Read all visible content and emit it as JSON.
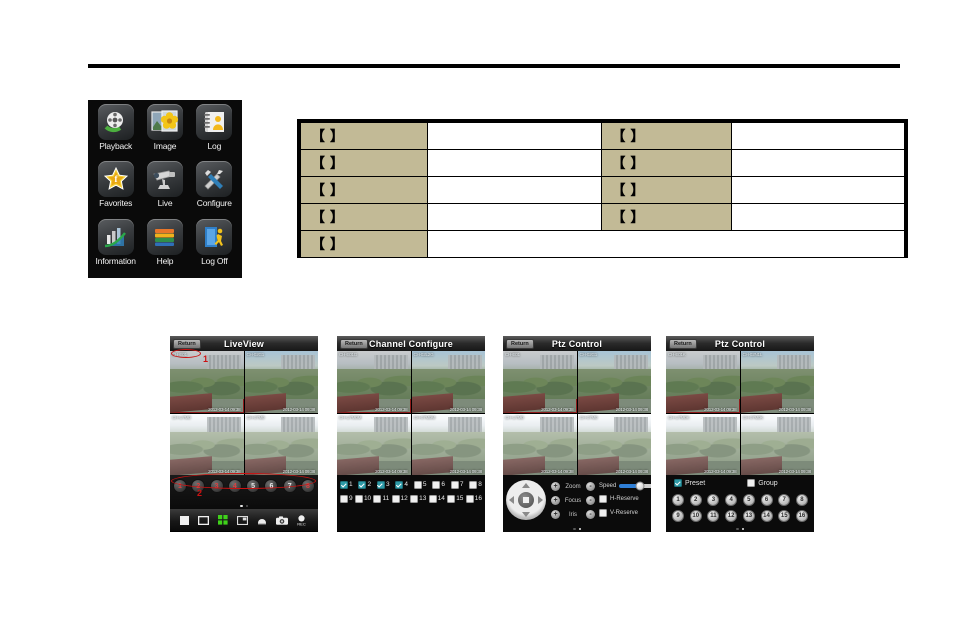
{
  "page": {
    "rule": "horizontal-rule"
  },
  "app_grid": {
    "items": [
      {
        "label": "Playback",
        "icon": "film-reel-icon"
      },
      {
        "label": "Image",
        "icon": "photo-flower-icon"
      },
      {
        "label": "Log",
        "icon": "notebook-person-icon"
      },
      {
        "label": "Favorites",
        "icon": "star-favorite-icon"
      },
      {
        "label": "Live",
        "icon": "camera-cctv-icon"
      },
      {
        "label": "Configure",
        "icon": "wrench-screwdriver-icon"
      },
      {
        "label": "Information",
        "icon": "bar-chart-icon"
      },
      {
        "label": "Help",
        "icon": "books-icon"
      },
      {
        "label": "Log Off",
        "icon": "exit-door-icon"
      }
    ]
  },
  "spec_table": {
    "colors": {
      "key_bg": "#c2ba96",
      "value_bg": "#ffffff",
      "border": "#000000"
    },
    "rows": [
      {
        "k1": "【            】",
        "v1": "",
        "k2": "【        】",
        "v2": ""
      },
      {
        "k1": "【      】",
        "v1": "",
        "k2": "【              】",
        "v2": ""
      },
      {
        "k1": "【      】",
        "v1": "",
        "k2": "【           】",
        "v2": ""
      },
      {
        "k1": "【           】",
        "v1": "",
        "k2": "【      】",
        "v2": ""
      },
      {
        "k1": "【        】",
        "v1": "",
        "merged": true
      }
    ]
  },
  "phones": [
    {
      "name": "liveview",
      "header": {
        "return_label": "Return",
        "title": "LiveView"
      },
      "tiles": [
        {
          "channel": "CH-E01",
          "timestamp": "2012-03-14 09:38",
          "selected": true
        },
        {
          "channel": "CH-02G1",
          "timestamp": "2012-03-14 09:38",
          "selected": false
        },
        {
          "channel": "CH-U7M0",
          "timestamp": "2012-03-14 09:38",
          "selected": false
        },
        {
          "channel": "CH-07M0",
          "timestamp": "2012-03-14 09:38",
          "selected": false
        }
      ],
      "channel_buttons": [
        "1",
        "2",
        "3",
        "4",
        "5",
        "6",
        "7",
        "8"
      ],
      "active_channels": [
        1,
        2,
        3,
        4
      ],
      "page_dots": 2,
      "page_dot_active": 1,
      "toolbar": [
        {
          "icon": "single-view-icon"
        },
        {
          "icon": "full-screen-icon"
        },
        {
          "icon": "quad-view-icon"
        },
        {
          "icon": "split-view-icon"
        },
        {
          "icon": "dome-ptz-icon"
        },
        {
          "icon": "snapshot-camera-icon"
        },
        {
          "icon": "record-rec-icon"
        }
      ],
      "annotations": [
        {
          "num": "1",
          "target": "channel-label"
        },
        {
          "num": "2",
          "target": "channel-button-row"
        }
      ]
    },
    {
      "name": "channel-configure",
      "header": {
        "return_label": "Return",
        "title": "Channel Configure"
      },
      "tiles": [
        {
          "channel": "CH-E01G",
          "timestamp": "2012-03-14 09:38",
          "selected": true
        },
        {
          "channel": "CH-02L2G",
          "timestamp": "2012-03-14 09:38",
          "selected": false
        },
        {
          "channel": "CH-U7M0M",
          "timestamp": "2012-03-14 09:38",
          "selected": false
        },
        {
          "channel": "CH-07M0M",
          "timestamp": "2012-03-14 09:38",
          "selected": false
        }
      ],
      "checkbox_rows": [
        [
          "1",
          "2",
          "3",
          "4",
          "5",
          "6",
          "7",
          "8"
        ],
        [
          "9",
          "10",
          "11",
          "12",
          "13",
          "14",
          "15",
          "16"
        ]
      ],
      "checked": [
        "1",
        "2",
        "3",
        "4"
      ]
    },
    {
      "name": "ptz-control-pad",
      "header": {
        "return_label": "Return",
        "title": "Ptz Control"
      },
      "tiles": [
        {
          "channel": "CH-E01",
          "timestamp": "2012-03-14 09:38",
          "selected": true
        },
        {
          "channel": "CH-02G1",
          "timestamp": "2012-03-14 09:38",
          "selected": false
        },
        {
          "channel": "CH-U7M0",
          "timestamp": "2012-03-14 09:38",
          "selected": false
        },
        {
          "channel": "CH-07M0",
          "timestamp": "2012-03-14 09:38",
          "selected": false
        }
      ],
      "dpad": {
        "icon": "direction-pad-icon",
        "center": "stop-icon"
      },
      "controls": [
        {
          "label": "Zoom",
          "plus": "+",
          "minus": "-"
        },
        {
          "label": "Focus",
          "plus": "+",
          "minus": "-"
        },
        {
          "label": "Iris",
          "plus": "+",
          "minus": "-"
        }
      ],
      "speed": {
        "label": "Speed",
        "value": 55
      },
      "reserves": [
        {
          "label": "H-Reserve",
          "checked": false
        },
        {
          "label": "V-Reserve",
          "checked": false
        }
      ],
      "page_dots": 2,
      "page_dot_active": 2
    },
    {
      "name": "ptz-control-preset",
      "header": {
        "return_label": "Return",
        "title": "Ptz Control"
      },
      "tiles": [
        {
          "channel": "CH-E01K",
          "timestamp": "2012-03-14 09:38",
          "selected": true
        },
        {
          "channel": "CH-02N1L",
          "timestamp": "2012-03-14 09:38",
          "selected": false
        },
        {
          "channel": "CH-U7M0K",
          "timestamp": "2012-03-14 09:38",
          "selected": false
        },
        {
          "channel": "CH-07M0K",
          "timestamp": "2012-03-14 09:38",
          "selected": false
        }
      ],
      "modes": [
        {
          "label": "Preset",
          "checked": true
        },
        {
          "label": "Group",
          "checked": false
        }
      ],
      "preset_rows": [
        [
          "1",
          "2",
          "3",
          "4",
          "5",
          "6",
          "7",
          "8"
        ],
        [
          "9",
          "10",
          "11",
          "12",
          "13",
          "14",
          "15",
          "16"
        ]
      ],
      "page_dots": 2,
      "page_dot_active": 2
    }
  ]
}
